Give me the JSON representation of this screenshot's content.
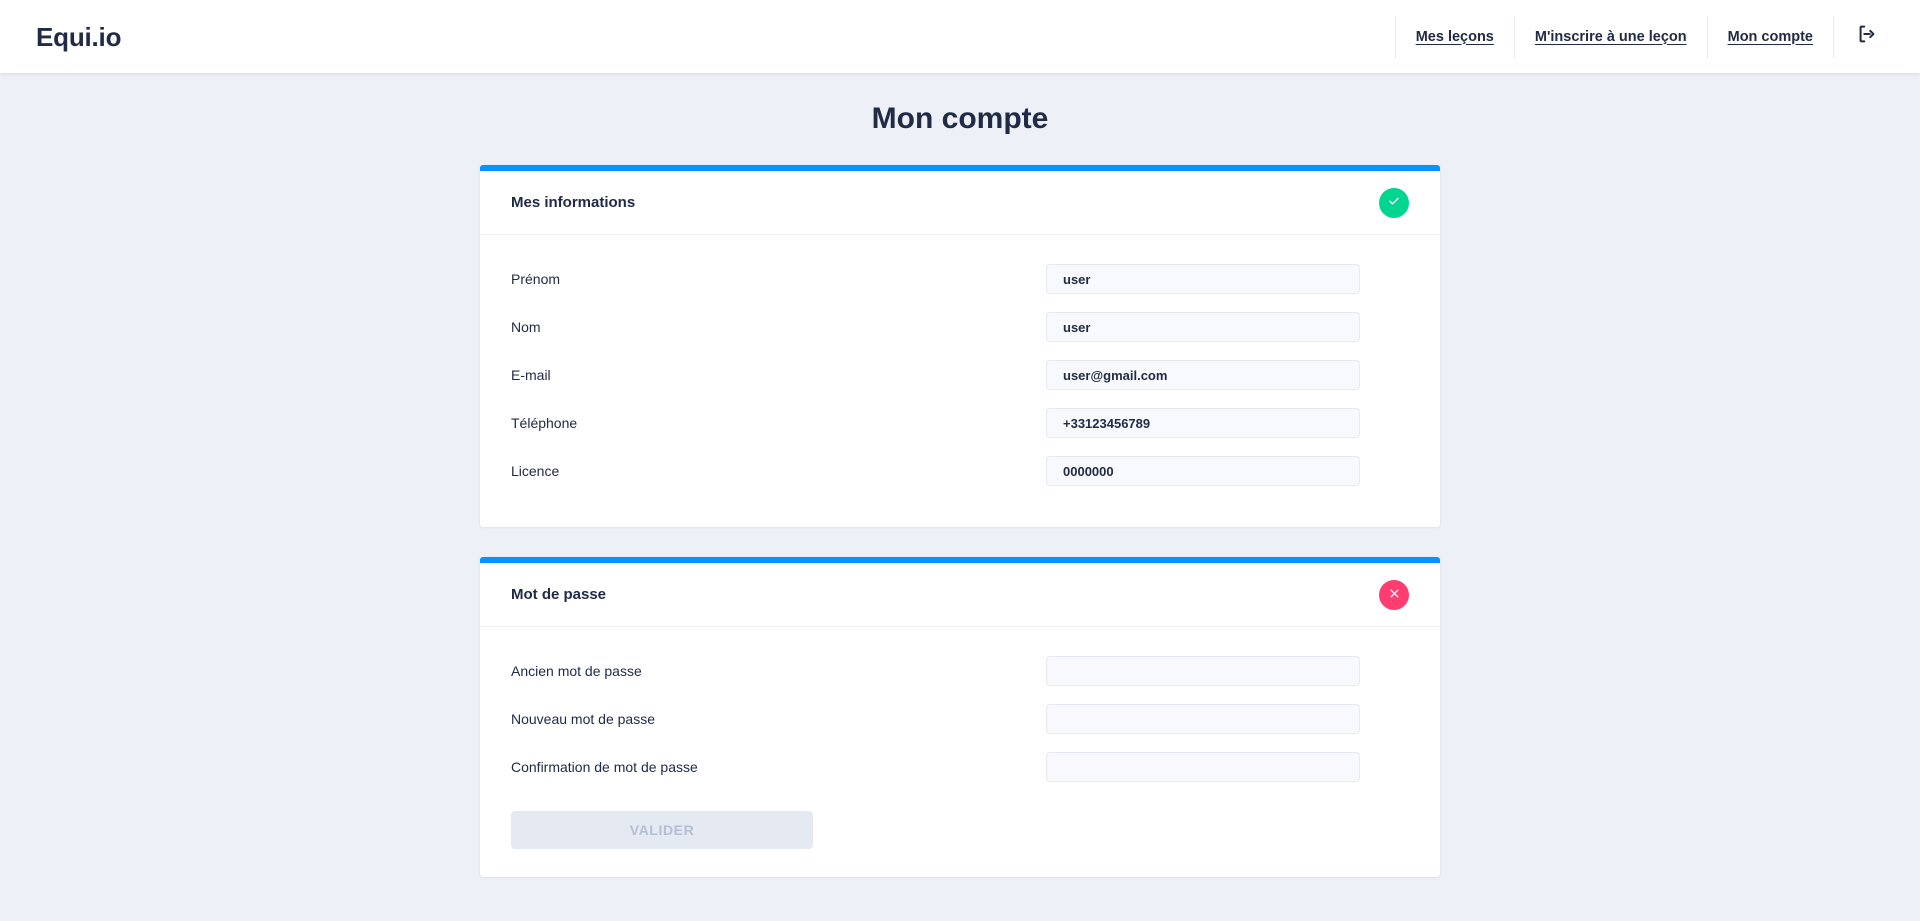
{
  "header": {
    "brand": "Equi.io",
    "nav": [
      {
        "label": "Mes leçons",
        "name": "nav-mes-lecons"
      },
      {
        "label": "M'inscrire à une leçon",
        "name": "nav-minscrire-a-une-lecon"
      },
      {
        "label": "Mon compte",
        "name": "nav-mon-compte"
      }
    ],
    "logout_icon": "logout-icon"
  },
  "page": {
    "title": "Mon compte"
  },
  "info_card": {
    "title": "Mes informations",
    "status_icon": "check-icon",
    "status_color": "#00d68f",
    "accent_color": "#0095ff",
    "fields": [
      {
        "label": "Prénom",
        "value": "user",
        "placeholder": ""
      },
      {
        "label": "Nom",
        "value": "user",
        "placeholder": ""
      },
      {
        "label": "E-mail",
        "value": "user@gmail.com",
        "placeholder": ""
      },
      {
        "label": "Téléphone",
        "value": "+33123456789",
        "placeholder": ""
      },
      {
        "label": "Licence",
        "value": "0000000",
        "placeholder": ""
      }
    ]
  },
  "password_card": {
    "title": "Mot de passe",
    "status_icon": "close-icon",
    "status_color": "#ff3d71",
    "accent_color": "#0095ff",
    "fields": [
      {
        "label": "Ancien mot de passe",
        "value": "",
        "placeholder": ""
      },
      {
        "label": "Nouveau mot de passe",
        "value": "",
        "placeholder": ""
      },
      {
        "label": "Confirmation de mot de passe",
        "value": "",
        "placeholder": ""
      }
    ],
    "submit_label": "VALIDER"
  }
}
